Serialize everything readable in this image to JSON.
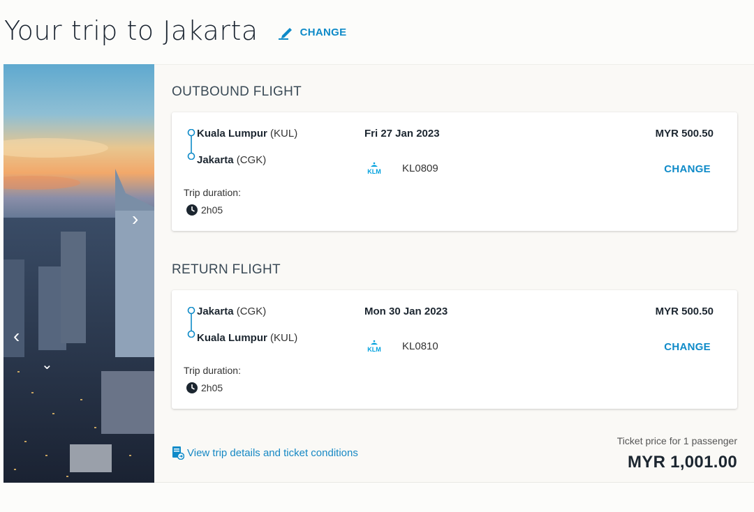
{
  "header": {
    "title": "Your trip to Jakarta",
    "change_label": "CHANGE",
    "change_icon": "pencil-icon"
  },
  "hero": {
    "prev_icon": "chevron-left-icon",
    "next_icon": "chevron-right-icon",
    "down_icon": "chevron-down-icon"
  },
  "outbound": {
    "section_title": "OUTBOUND FLIGHT",
    "from_city": "Kuala Lumpur",
    "from_code": "(KUL)",
    "to_city": "Jakarta",
    "to_code": "(CGK)",
    "date": "Fri 27 Jan 2023",
    "airline_logo": "KLM",
    "flight_number": "KL0809",
    "price": "MYR 500.50",
    "change_label": "CHANGE",
    "duration_label": "Trip duration:",
    "duration": "2h05"
  },
  "return": {
    "section_title": "RETURN FLIGHT",
    "from_city": "Jakarta",
    "from_code": "(CGK)",
    "to_city": "Kuala Lumpur",
    "to_code": "(KUL)",
    "date": "Mon 30 Jan 2023",
    "airline_logo": "KLM",
    "flight_number": "KL0810",
    "price": "MYR 500.50",
    "change_label": "CHANGE",
    "duration_label": "Trip duration:",
    "duration": "2h05"
  },
  "footer": {
    "details_link": "View trip details and ticket conditions",
    "total_label": "Ticket price for 1 passenger",
    "total_price": "MYR 1,001.00"
  },
  "colors": {
    "accent": "#0e8ac8",
    "klm_blue": "#00a1de",
    "title": "#1a2430"
  }
}
